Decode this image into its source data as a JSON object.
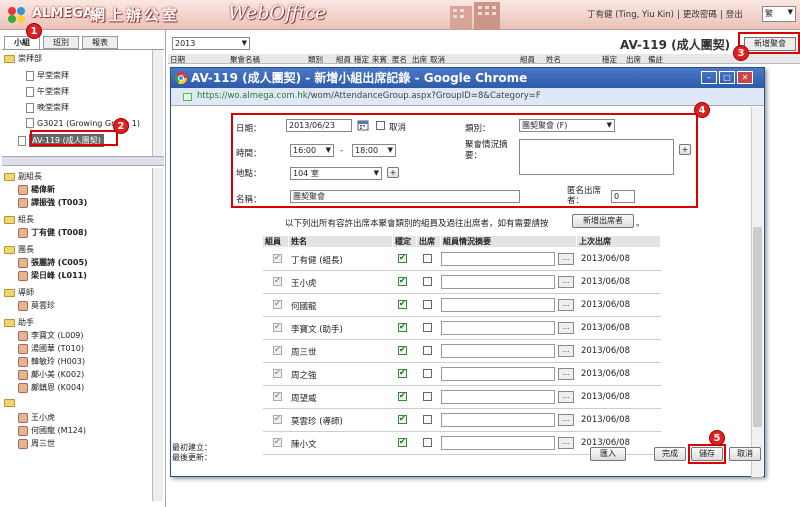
{
  "header": {
    "brand": "ALMEGA",
    "brand_cn": "網上辦公室",
    "brand_web": "WebOffice",
    "user": "丁有健 (Ting, Yiu Kin)",
    "change_password": "更改密碼",
    "logout": "登出",
    "lang": "繁"
  },
  "tabs": [
    "小組",
    "班別",
    "報表"
  ],
  "tree": {
    "dept": "崇拜部",
    "items": [
      "早堂崇拜",
      "午堂崇拜",
      "晚堂崇拜",
      "G3021 (Growing Group 1)"
    ],
    "selected": "AV-119 (成人團契)"
  },
  "members": {
    "groups": [
      {
        "title": "副組長",
        "people": [
          "楊偉新",
          "譚振強 (T003)"
        ]
      },
      {
        "title": "組長",
        "people": [
          "丁有健 (T008)"
        ]
      },
      {
        "title": "團長",
        "people": [
          "張麗詩 (C005)",
          "梁日峰 (L011)"
        ]
      },
      {
        "title": "導師",
        "people": [
          "莫雲珍"
        ]
      },
      {
        "title": "助手",
        "people": [
          "李寶文 (L009)",
          "湯國華 (T010)",
          "韓敏玲 (H003)",
          "鄺小美 (K002)",
          "鄺鎮恩 (K004)"
        ]
      },
      {
        "title": "",
        "people": [
          "王小虎",
          "何國龍 (M124)",
          "周三世"
        ]
      }
    ]
  },
  "main": {
    "year": "2013",
    "group_title": "AV-119 (成人團契)",
    "new_button": "新增聚會",
    "columns": [
      "日期",
      "聚會名稱",
      "類別",
      "組員",
      "穩定",
      "來賓",
      "匿名",
      "出席",
      "取消",
      "組員",
      "姓名",
      "穩定",
      "出席",
      "備註"
    ]
  },
  "dialog": {
    "title": "AV-119 (成人團契) - 新增小組出席記錄 - Google Chrome",
    "url_host": "https://wo.almega.com.hk",
    "url_path": "/wom/AttendanceGroup.aspx?GroupID=8&Category=F",
    "form": {
      "date_label": "日期：",
      "date_value": "2013/06/23",
      "cancel_label": "取消",
      "type_label": "類別：",
      "type_value": "團契聚會 (F)",
      "time_label": "時間：",
      "time_from": "16:00",
      "time_dash": "-",
      "time_to": "18:00",
      "summary_label": "聚會情況摘要：",
      "place_label": "地點：",
      "place_value": "104 室",
      "name_label": "名稱：",
      "name_value": "團契聚會",
      "anon_label": "匿名出席者：",
      "anon_value": "0"
    },
    "note": "以下列出所有容許出席本聚會類別的組員及過往出席者，如有需要請按",
    "note_button": "新增出席者",
    "note_end": "。",
    "table": {
      "headers": [
        "組員",
        "姓名",
        "穩定",
        "出席",
        "組員情況摘要",
        "上次出席"
      ],
      "rows": [
        {
          "name": "丁有健 (組長)",
          "date": "2013/06/08"
        },
        {
          "name": "王小虎",
          "date": "2013/06/08"
        },
        {
          "name": "何國龍",
          "date": "2013/06/08"
        },
        {
          "name": "李寶文 (助手)",
          "date": "2013/06/08"
        },
        {
          "name": "周三世",
          "date": "2013/06/08"
        },
        {
          "name": "周之強",
          "date": "2013/06/08"
        },
        {
          "name": "周望威",
          "date": "2013/06/08"
        },
        {
          "name": "莫雲珍 (導師)",
          "date": "2013/06/08"
        },
        {
          "name": "陳小文",
          "date": "2013/06/08"
        }
      ]
    },
    "more": "...",
    "footer_created": "最初建立：",
    "footer_updated": "最後更新：",
    "btn_import": "匯入",
    "btn_done": "完成",
    "btn_save": "儲存",
    "btn_cancel": "取消"
  },
  "callouts": [
    "1",
    "2",
    "3",
    "4",
    "5"
  ]
}
